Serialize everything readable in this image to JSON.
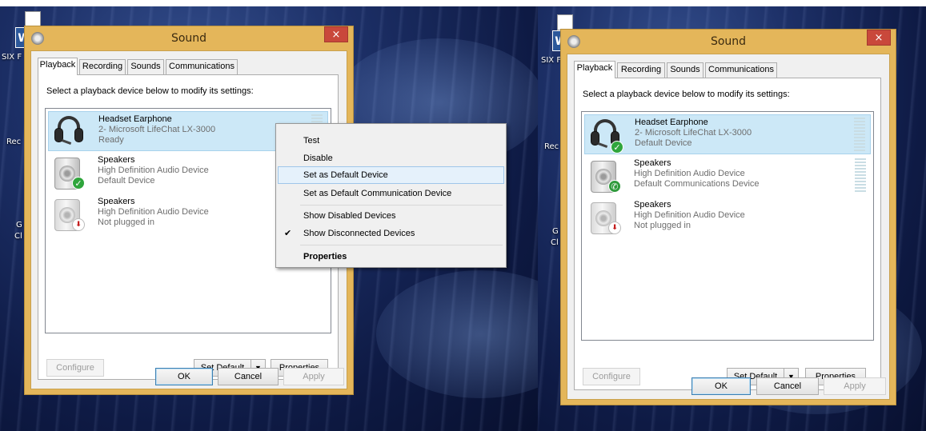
{
  "dialog": {
    "title": "Sound",
    "close_glyph": "×",
    "tabs": [
      "Playback",
      "Recording",
      "Sounds",
      "Communications"
    ],
    "instruction": "Select a playback device below to modify its settings:",
    "buttons": {
      "configure": "Configure",
      "set_default": "Set Default",
      "properties": "Properties",
      "ok": "OK",
      "cancel": "Cancel",
      "apply": "Apply"
    }
  },
  "desktop_labels": {
    "six": "SIX F",
    "rec": "Rec",
    "g": "G",
    "c": "Cl",
    "w": "W"
  },
  "left": {
    "devices": [
      {
        "name": "Headset Earphone",
        "line1": "2- Microsoft LifeChat LX-3000",
        "line2": "Ready",
        "icon": "headset-icon",
        "badge": ""
      },
      {
        "name": "Speakers",
        "line1": "High Definition Audio Device",
        "line2": "Default Device",
        "icon": "speaker-icon",
        "badge": "check"
      },
      {
        "name": "Speakers",
        "line1": "High Definition Audio Device",
        "line2": "Not plugged in",
        "icon": "speaker-icon",
        "badge": "unplugged"
      }
    ],
    "context_menu": {
      "items": [
        {
          "label": "Test",
          "checked": false,
          "highlighted": false,
          "bold": false
        },
        {
          "label": "Disable",
          "checked": false,
          "highlighted": false,
          "bold": false
        },
        {
          "label": "Set as Default Device",
          "checked": false,
          "highlighted": true,
          "bold": false
        },
        {
          "label": "Set as Default Communication Device",
          "checked": false,
          "highlighted": false,
          "bold": false
        },
        {
          "label": "Show Disabled Devices",
          "checked": false,
          "highlighted": false,
          "bold": false
        },
        {
          "label": "Show Disconnected Devices",
          "checked": true,
          "highlighted": false,
          "bold": false
        },
        {
          "label": "Properties",
          "checked": false,
          "highlighted": false,
          "bold": true
        }
      ],
      "check_glyph": "✔"
    }
  },
  "right": {
    "devices": [
      {
        "name": "Headset Earphone",
        "line1": "2- Microsoft LifeChat LX-3000",
        "line2": "Default Device",
        "icon": "headset-icon",
        "badge": "check"
      },
      {
        "name": "Speakers",
        "line1": "High Definition Audio Device",
        "line2": "Default Communications Device",
        "icon": "speaker-icon",
        "badge": "phone"
      },
      {
        "name": "Speakers",
        "line1": "High Definition Audio Device",
        "line2": "Not plugged in",
        "icon": "speaker-icon",
        "badge": "unplugged"
      }
    ]
  },
  "colors": {
    "title_bar": "#e4b65a",
    "close_button": "#c9483b",
    "selection": "#cce8f7",
    "menu_highlight": "#e5f1fb"
  }
}
